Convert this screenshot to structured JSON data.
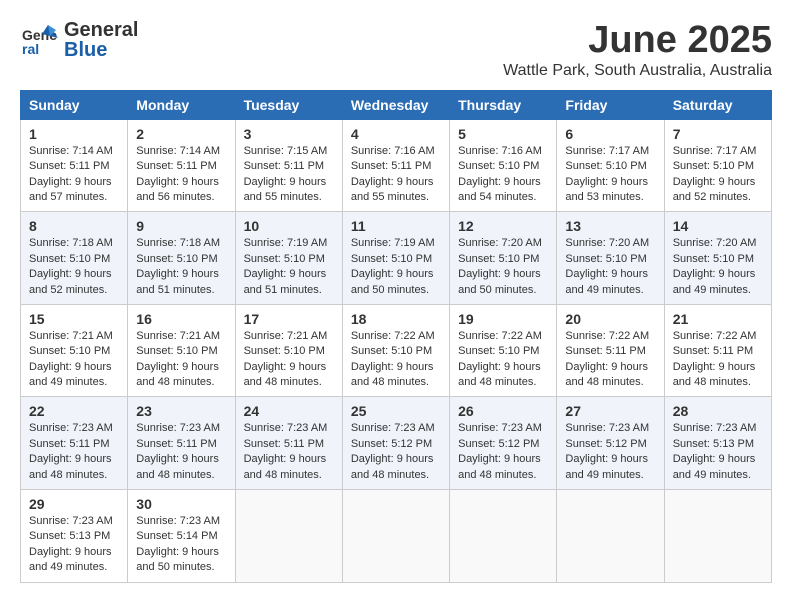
{
  "header": {
    "logo_general": "General",
    "logo_blue": "Blue",
    "month_title": "June 2025",
    "subtitle": "Wattle Park, South Australia, Australia"
  },
  "days_of_week": [
    "Sunday",
    "Monday",
    "Tuesday",
    "Wednesday",
    "Thursday",
    "Friday",
    "Saturday"
  ],
  "weeks": [
    [
      {
        "day": "1",
        "sunrise": "7:14 AM",
        "sunset": "5:11 PM",
        "daylight": "9 hours and 57 minutes."
      },
      {
        "day": "2",
        "sunrise": "7:14 AM",
        "sunset": "5:11 PM",
        "daylight": "9 hours and 56 minutes."
      },
      {
        "day": "3",
        "sunrise": "7:15 AM",
        "sunset": "5:11 PM",
        "daylight": "9 hours and 55 minutes."
      },
      {
        "day": "4",
        "sunrise": "7:16 AM",
        "sunset": "5:11 PM",
        "daylight": "9 hours and 55 minutes."
      },
      {
        "day": "5",
        "sunrise": "7:16 AM",
        "sunset": "5:10 PM",
        "daylight": "9 hours and 54 minutes."
      },
      {
        "day": "6",
        "sunrise": "7:17 AM",
        "sunset": "5:10 PM",
        "daylight": "9 hours and 53 minutes."
      },
      {
        "day": "7",
        "sunrise": "7:17 AM",
        "sunset": "5:10 PM",
        "daylight": "9 hours and 52 minutes."
      }
    ],
    [
      {
        "day": "8",
        "sunrise": "7:18 AM",
        "sunset": "5:10 PM",
        "daylight": "9 hours and 52 minutes."
      },
      {
        "day": "9",
        "sunrise": "7:18 AM",
        "sunset": "5:10 PM",
        "daylight": "9 hours and 51 minutes."
      },
      {
        "day": "10",
        "sunrise": "7:19 AM",
        "sunset": "5:10 PM",
        "daylight": "9 hours and 51 minutes."
      },
      {
        "day": "11",
        "sunrise": "7:19 AM",
        "sunset": "5:10 PM",
        "daylight": "9 hours and 50 minutes."
      },
      {
        "day": "12",
        "sunrise": "7:20 AM",
        "sunset": "5:10 PM",
        "daylight": "9 hours and 50 minutes."
      },
      {
        "day": "13",
        "sunrise": "7:20 AM",
        "sunset": "5:10 PM",
        "daylight": "9 hours and 49 minutes."
      },
      {
        "day": "14",
        "sunrise": "7:20 AM",
        "sunset": "5:10 PM",
        "daylight": "9 hours and 49 minutes."
      }
    ],
    [
      {
        "day": "15",
        "sunrise": "7:21 AM",
        "sunset": "5:10 PM",
        "daylight": "9 hours and 49 minutes."
      },
      {
        "day": "16",
        "sunrise": "7:21 AM",
        "sunset": "5:10 PM",
        "daylight": "9 hours and 48 minutes."
      },
      {
        "day": "17",
        "sunrise": "7:21 AM",
        "sunset": "5:10 PM",
        "daylight": "9 hours and 48 minutes."
      },
      {
        "day": "18",
        "sunrise": "7:22 AM",
        "sunset": "5:10 PM",
        "daylight": "9 hours and 48 minutes."
      },
      {
        "day": "19",
        "sunrise": "7:22 AM",
        "sunset": "5:10 PM",
        "daylight": "9 hours and 48 minutes."
      },
      {
        "day": "20",
        "sunrise": "7:22 AM",
        "sunset": "5:11 PM",
        "daylight": "9 hours and 48 minutes."
      },
      {
        "day": "21",
        "sunrise": "7:22 AM",
        "sunset": "5:11 PM",
        "daylight": "9 hours and 48 minutes."
      }
    ],
    [
      {
        "day": "22",
        "sunrise": "7:23 AM",
        "sunset": "5:11 PM",
        "daylight": "9 hours and 48 minutes."
      },
      {
        "day": "23",
        "sunrise": "7:23 AM",
        "sunset": "5:11 PM",
        "daylight": "9 hours and 48 minutes."
      },
      {
        "day": "24",
        "sunrise": "7:23 AM",
        "sunset": "5:11 PM",
        "daylight": "9 hours and 48 minutes."
      },
      {
        "day": "25",
        "sunrise": "7:23 AM",
        "sunset": "5:12 PM",
        "daylight": "9 hours and 48 minutes."
      },
      {
        "day": "26",
        "sunrise": "7:23 AM",
        "sunset": "5:12 PM",
        "daylight": "9 hours and 48 minutes."
      },
      {
        "day": "27",
        "sunrise": "7:23 AM",
        "sunset": "5:12 PM",
        "daylight": "9 hours and 49 minutes."
      },
      {
        "day": "28",
        "sunrise": "7:23 AM",
        "sunset": "5:13 PM",
        "daylight": "9 hours and 49 minutes."
      }
    ],
    [
      {
        "day": "29",
        "sunrise": "7:23 AM",
        "sunset": "5:13 PM",
        "daylight": "9 hours and 49 minutes."
      },
      {
        "day": "30",
        "sunrise": "7:23 AM",
        "sunset": "5:14 PM",
        "daylight": "9 hours and 50 minutes."
      },
      null,
      null,
      null,
      null,
      null
    ]
  ]
}
